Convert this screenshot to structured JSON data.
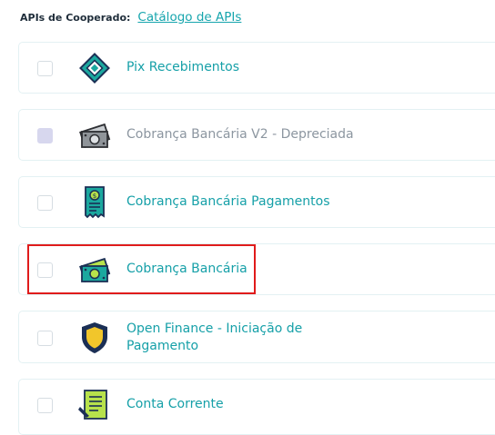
{
  "header": {
    "label": "APIs de Cooperado:",
    "link": "Catálogo de APIs"
  },
  "apis": [
    {
      "name": "Pix Recebimentos",
      "icon": "pix-icon",
      "disabled": false,
      "selected": false
    },
    {
      "name": "Cobrança Bancária V2 - Depreciada",
      "icon": "money-bill-icon",
      "disabled": true,
      "selected": false
    },
    {
      "name": "Cobrança Bancária Pagamentos",
      "icon": "receipt-icon",
      "disabled": false,
      "selected": false
    },
    {
      "name": "Cobrança Bancária",
      "icon": "money-bill-icon",
      "disabled": false,
      "selected": false,
      "highlighted": true
    },
    {
      "name_line1": "Open Finance - Iniciação de",
      "name_line2": "Pagamento",
      "icon": "shield-icon",
      "disabled": false,
      "selected": false
    },
    {
      "name": "Conta Corrente",
      "icon": "notepad-icon",
      "disabled": false,
      "selected": false
    }
  ],
  "colors": {
    "accent": "#16a5ad",
    "highlight": "#e01b1b",
    "icon_green": "#b7e24b",
    "icon_teal": "#1ba89f",
    "icon_navy": "#1b2f55"
  }
}
